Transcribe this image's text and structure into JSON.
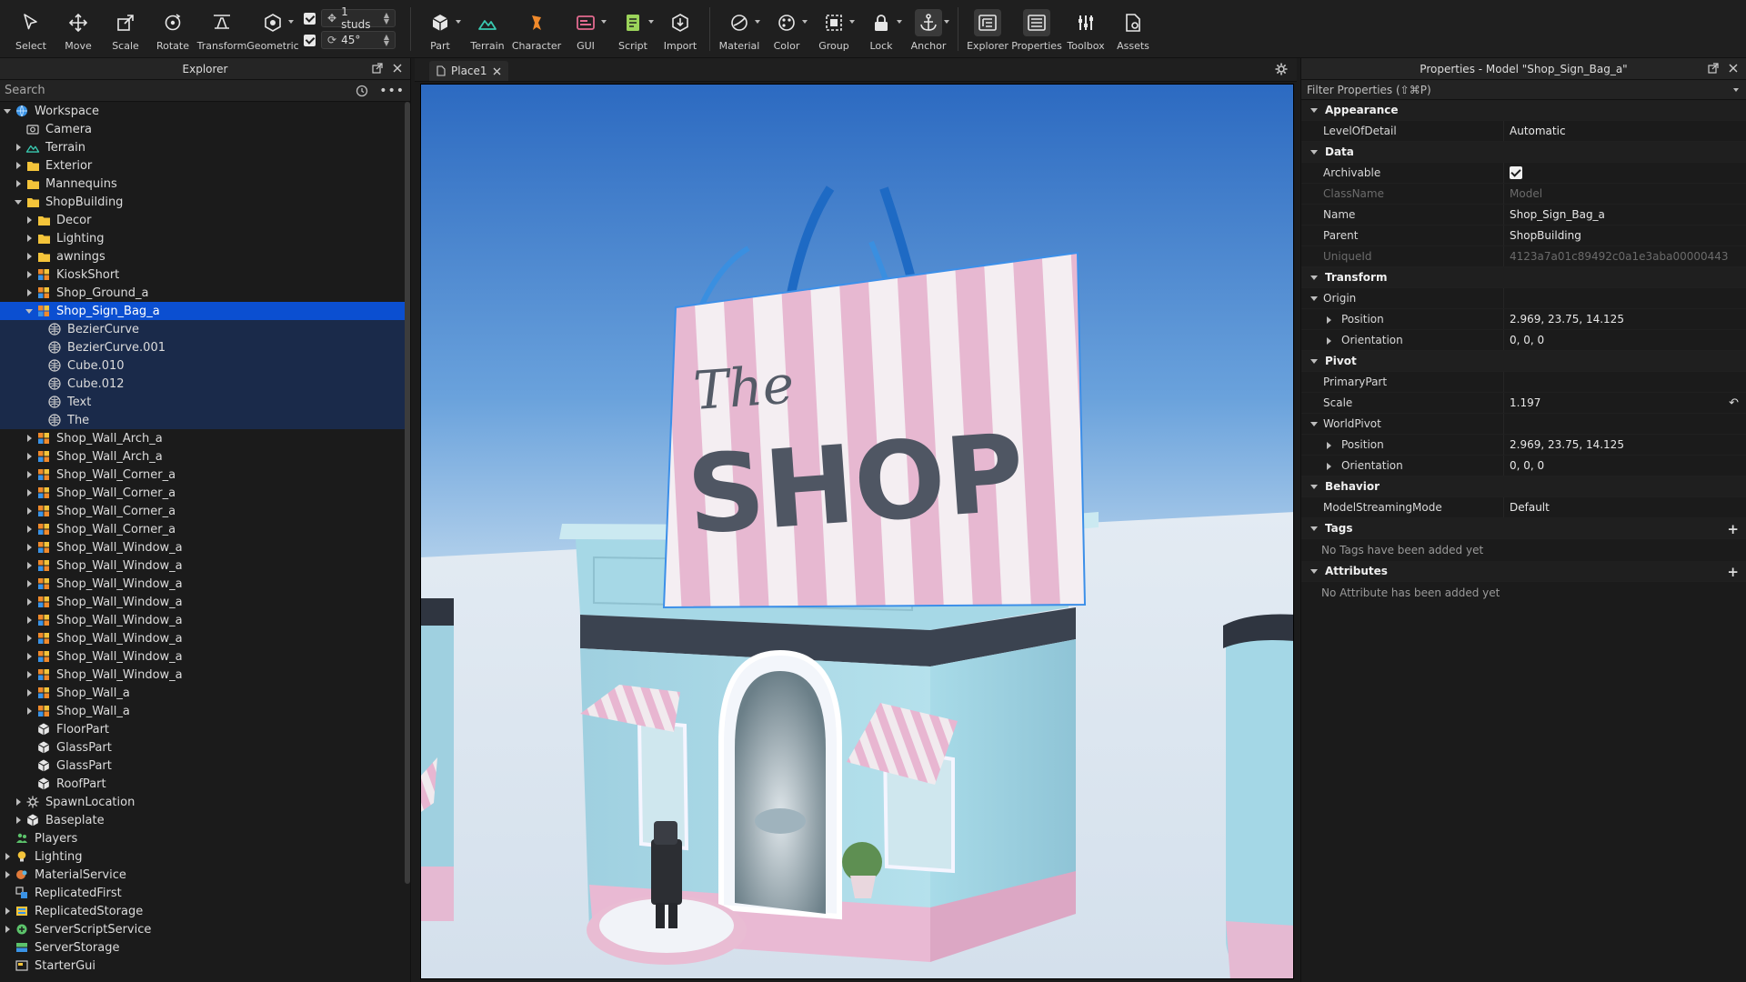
{
  "toolbar": {
    "tools": [
      {
        "label": "Select",
        "icon": "cursor-icon"
      },
      {
        "label": "Move",
        "icon": "move-icon"
      },
      {
        "label": "Scale",
        "icon": "scale-icon"
      },
      {
        "label": "Rotate",
        "icon": "rotate-icon"
      },
      {
        "label": "Transform",
        "icon": "transform-icon"
      },
      {
        "label": "Geometric",
        "icon": "geometric-icon"
      }
    ],
    "snap": {
      "move_value": "1 studs",
      "rotate_value": "45°"
    },
    "insert": [
      {
        "label": "Part",
        "icon": "part-icon"
      },
      {
        "label": "Terrain",
        "icon": "terrain-icon"
      },
      {
        "label": "Character",
        "icon": "character-icon"
      },
      {
        "label": "GUI",
        "icon": "gui-icon"
      },
      {
        "label": "Script",
        "icon": "script-icon"
      },
      {
        "label": "Import",
        "icon": "import-icon"
      }
    ],
    "edit": [
      {
        "label": "Material",
        "icon": "material-icon"
      },
      {
        "label": "Color",
        "icon": "color-icon"
      },
      {
        "label": "Group",
        "icon": "group-icon"
      },
      {
        "label": "Lock",
        "icon": "lock-icon"
      },
      {
        "label": "Anchor",
        "icon": "anchor-icon"
      }
    ],
    "view": [
      {
        "label": "Explorer",
        "icon": "explorer-icon"
      },
      {
        "label": "Properties",
        "icon": "properties-icon"
      },
      {
        "label": "Toolbox",
        "icon": "toolbox-icon"
      },
      {
        "label": "Assets",
        "icon": "assets-icon"
      }
    ]
  },
  "explorer": {
    "title": "Explorer",
    "search_placeholder": "Search",
    "items": [
      {
        "label": "Workspace",
        "depth": 0,
        "twisty": "down",
        "icon": "globe-icon"
      },
      {
        "label": "Camera",
        "depth": 1,
        "twisty": "",
        "icon": "camera-icon"
      },
      {
        "label": "Terrain",
        "depth": 1,
        "twisty": "right",
        "icon": "terrain-icon"
      },
      {
        "label": "Exterior",
        "depth": 1,
        "twisty": "right",
        "icon": "folder-icon"
      },
      {
        "label": "Mannequins",
        "depth": 1,
        "twisty": "right",
        "icon": "folder-icon"
      },
      {
        "label": "ShopBuilding",
        "depth": 1,
        "twisty": "down",
        "icon": "folder-icon"
      },
      {
        "label": "Decor",
        "depth": 2,
        "twisty": "right",
        "icon": "folder-icon"
      },
      {
        "label": "Lighting",
        "depth": 2,
        "twisty": "right",
        "icon": "folder-icon"
      },
      {
        "label": "awnings",
        "depth": 2,
        "twisty": "right",
        "icon": "folder-icon"
      },
      {
        "label": "KioskShort",
        "depth": 2,
        "twisty": "right",
        "icon": "model-icon"
      },
      {
        "label": "Shop_Ground_a",
        "depth": 2,
        "twisty": "right",
        "icon": "model-icon"
      },
      {
        "label": "Shop_Sign_Bag_a",
        "depth": 2,
        "twisty": "down",
        "icon": "model-icon",
        "state": "selected"
      },
      {
        "label": "BezierCurve",
        "depth": 3,
        "twisty": "",
        "icon": "mesh-icon",
        "state": "sub"
      },
      {
        "label": "BezierCurve.001",
        "depth": 3,
        "twisty": "",
        "icon": "mesh-icon",
        "state": "sub"
      },
      {
        "label": "Cube.010",
        "depth": 3,
        "twisty": "",
        "icon": "mesh-icon",
        "state": "sub"
      },
      {
        "label": "Cube.012",
        "depth": 3,
        "twisty": "",
        "icon": "mesh-icon",
        "state": "sub"
      },
      {
        "label": "Text",
        "depth": 3,
        "twisty": "",
        "icon": "mesh-icon",
        "state": "sub"
      },
      {
        "label": "The",
        "depth": 3,
        "twisty": "",
        "icon": "mesh-icon",
        "state": "sub"
      },
      {
        "label": "Shop_Wall_Arch_a",
        "depth": 2,
        "twisty": "right",
        "icon": "model-icon"
      },
      {
        "label": "Shop_Wall_Arch_a",
        "depth": 2,
        "twisty": "right",
        "icon": "model-icon"
      },
      {
        "label": "Shop_Wall_Corner_a",
        "depth": 2,
        "twisty": "right",
        "icon": "model-icon"
      },
      {
        "label": "Shop_Wall_Corner_a",
        "depth": 2,
        "twisty": "right",
        "icon": "model-icon"
      },
      {
        "label": "Shop_Wall_Corner_a",
        "depth": 2,
        "twisty": "right",
        "icon": "model-icon"
      },
      {
        "label": "Shop_Wall_Corner_a",
        "depth": 2,
        "twisty": "right",
        "icon": "model-icon"
      },
      {
        "label": "Shop_Wall_Window_a",
        "depth": 2,
        "twisty": "right",
        "icon": "model-icon"
      },
      {
        "label": "Shop_Wall_Window_a",
        "depth": 2,
        "twisty": "right",
        "icon": "model-icon"
      },
      {
        "label": "Shop_Wall_Window_a",
        "depth": 2,
        "twisty": "right",
        "icon": "model-icon"
      },
      {
        "label": "Shop_Wall_Window_a",
        "depth": 2,
        "twisty": "right",
        "icon": "model-icon"
      },
      {
        "label": "Shop_Wall_Window_a",
        "depth": 2,
        "twisty": "right",
        "icon": "model-icon"
      },
      {
        "label": "Shop_Wall_Window_a",
        "depth": 2,
        "twisty": "right",
        "icon": "model-icon"
      },
      {
        "label": "Shop_Wall_Window_a",
        "depth": 2,
        "twisty": "right",
        "icon": "model-icon"
      },
      {
        "label": "Shop_Wall_Window_a",
        "depth": 2,
        "twisty": "right",
        "icon": "model-icon"
      },
      {
        "label": "Shop_Wall_a",
        "depth": 2,
        "twisty": "right",
        "icon": "model-icon"
      },
      {
        "label": "Shop_Wall_a",
        "depth": 2,
        "twisty": "right",
        "icon": "model-icon"
      },
      {
        "label": "FloorPart",
        "depth": 2,
        "twisty": "",
        "icon": "part-icon"
      },
      {
        "label": "GlassPart",
        "depth": 2,
        "twisty": "",
        "icon": "part-icon"
      },
      {
        "label": "GlassPart",
        "depth": 2,
        "twisty": "",
        "icon": "part-icon"
      },
      {
        "label": "RoofPart",
        "depth": 2,
        "twisty": "",
        "icon": "part-icon"
      },
      {
        "label": "SpawnLocation",
        "depth": 1,
        "twisty": "right",
        "icon": "spawn-icon"
      },
      {
        "label": "Baseplate",
        "depth": 1,
        "twisty": "right",
        "icon": "part-icon"
      },
      {
        "label": "Players",
        "depth": 0,
        "twisty": "",
        "icon": "players-icon"
      },
      {
        "label": "Lighting",
        "depth": 0,
        "twisty": "right",
        "icon": "lightbulb-icon"
      },
      {
        "label": "MaterialService",
        "depth": 0,
        "twisty": "right",
        "icon": "material-service-icon"
      },
      {
        "label": "ReplicatedFirst",
        "depth": 0,
        "twisty": "",
        "icon": "replicated-first-icon"
      },
      {
        "label": "ReplicatedStorage",
        "depth": 0,
        "twisty": "right",
        "icon": "replicated-storage-icon"
      },
      {
        "label": "ServerScriptService",
        "depth": 0,
        "twisty": "right",
        "icon": "server-script-service-icon"
      },
      {
        "label": "ServerStorage",
        "depth": 0,
        "twisty": "",
        "icon": "server-storage-icon"
      },
      {
        "label": "StarterGui",
        "depth": 0,
        "twisty": "",
        "icon": "starter-gui-icon"
      }
    ]
  },
  "viewport": {
    "tab_label": "Place1",
    "sign_text_script": "The",
    "sign_text_main": "SHOP"
  },
  "properties": {
    "title": "Properties - Model \"Shop_Sign_Bag_a\"",
    "filter_placeholder": "Filter Properties (⇧⌘P)",
    "rows": [
      {
        "kind": "cat",
        "name": "Appearance"
      },
      {
        "kind": "prop",
        "name": "LevelOfDetail",
        "value": "Automatic"
      },
      {
        "kind": "cat",
        "name": "Data"
      },
      {
        "kind": "prop",
        "name": "Archivable",
        "value": "",
        "checkbox": true
      },
      {
        "kind": "prop",
        "name": "ClassName",
        "value": "Model",
        "dim": true
      },
      {
        "kind": "prop",
        "name": "Name",
        "value": "Shop_Sign_Bag_a"
      },
      {
        "kind": "prop",
        "name": "Parent",
        "value": "ShopBuilding"
      },
      {
        "kind": "prop",
        "name": "UniqueId",
        "value": "4123a7a01c89492c0a1e3aba00000443",
        "dim": true
      },
      {
        "kind": "cat",
        "name": "Transform"
      },
      {
        "kind": "group",
        "name": "Origin",
        "value": ""
      },
      {
        "kind": "child",
        "name": "Position",
        "value": "2.969, 23.75, 14.125"
      },
      {
        "kind": "child",
        "name": "Orientation",
        "value": "0, 0, 0"
      },
      {
        "kind": "cat",
        "name": "Pivot"
      },
      {
        "kind": "prop",
        "name": "PrimaryPart",
        "value": ""
      },
      {
        "kind": "prop",
        "name": "Scale",
        "value": "1.197",
        "reset": true
      },
      {
        "kind": "group",
        "name": "WorldPivot",
        "value": ""
      },
      {
        "kind": "child",
        "name": "Position",
        "value": "2.969, 23.75, 14.125"
      },
      {
        "kind": "child",
        "name": "Orientation",
        "value": "0, 0, 0"
      },
      {
        "kind": "cat",
        "name": "Behavior"
      },
      {
        "kind": "prop",
        "name": "ModelStreamingMode",
        "value": "Default"
      },
      {
        "kind": "cat",
        "name": "Tags",
        "plus": true
      },
      {
        "kind": "note",
        "name": "No Tags have been added yet"
      },
      {
        "kind": "cat",
        "name": "Attributes",
        "plus": true
      },
      {
        "kind": "note",
        "name": "No Attribute has been added yet"
      }
    ]
  },
  "colors": {
    "selection": "#0b4fd1",
    "panel_bg": "#1b1b1b",
    "sky_top": "#2f6fc4",
    "shop_blue": "#a9dbe8",
    "shop_pink": "#e8b6d1"
  }
}
